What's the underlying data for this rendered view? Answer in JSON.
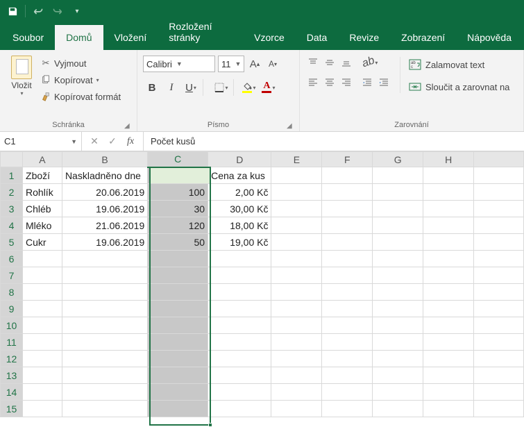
{
  "titlebar": {
    "save_icon": "save-icon",
    "undo_icon": "undo-icon",
    "redo_icon": "redo-icon",
    "customize_icon": "chevron-down-icon"
  },
  "tabs": {
    "items": [
      {
        "label": "Soubor"
      },
      {
        "label": "Domů"
      },
      {
        "label": "Vložení"
      },
      {
        "label": "Rozložení stránky"
      },
      {
        "label": "Vzorce"
      },
      {
        "label": "Data"
      },
      {
        "label": "Revize"
      },
      {
        "label": "Zobrazení"
      },
      {
        "label": "Nápověda"
      }
    ],
    "active_index": 1
  },
  "ribbon": {
    "clipboard": {
      "paste": "Vložit",
      "cut": "Vyjmout",
      "copy": "Kopírovat",
      "format_painter": "Kopírovat formát",
      "group_label": "Schránka"
    },
    "font": {
      "name": "Calibri",
      "size": "11",
      "increase": "A",
      "decrease": "A",
      "bold": "B",
      "italic": "I",
      "underline": "U",
      "fill_color": "#ffff00",
      "font_color": "#c00000",
      "group_label": "Písmo"
    },
    "alignment": {
      "wrap": "Zalamovat text",
      "merge": "Sloučit a zarovnat na",
      "group_label": "Zarovnání"
    }
  },
  "formula_bar": {
    "name_box": "C1",
    "fx_label": "fx",
    "value": "Počet kusů"
  },
  "grid": {
    "columns": [
      "A",
      "B",
      "C",
      "D",
      "E",
      "F",
      "G",
      "H",
      ""
    ],
    "selected_col_index": 2,
    "rows": [
      {
        "n": "1",
        "A": "Zboží",
        "B": "Naskladněno dne",
        "C": "Počet kusů",
        "D": "Cena za kus"
      },
      {
        "n": "2",
        "A": "Rohlík",
        "B": "20.06.2019",
        "C": "100",
        "D": "2,00 Kč"
      },
      {
        "n": "3",
        "A": "Chléb",
        "B": "19.06.2019",
        "C": "30",
        "D": "30,00 Kč"
      },
      {
        "n": "4",
        "A": "Mléko",
        "B": "21.06.2019",
        "C": "120",
        "D": "18,00 Kč"
      },
      {
        "n": "5",
        "A": "Cukr",
        "B": "19.06.2019",
        "C": "50",
        "D": "19,00 Kč"
      },
      {
        "n": "6"
      },
      {
        "n": "7"
      },
      {
        "n": "8"
      },
      {
        "n": "9"
      },
      {
        "n": "10"
      },
      {
        "n": "11"
      },
      {
        "n": "12"
      },
      {
        "n": "13"
      },
      {
        "n": "14"
      },
      {
        "n": "15"
      }
    ]
  },
  "chart_data": {
    "type": "table",
    "columns": [
      "Zboží",
      "Naskladněno dne",
      "Počet kusů",
      "Cena za kus"
    ],
    "rows": [
      [
        "Rohlík",
        "20.06.2019",
        100,
        "2,00 Kč"
      ],
      [
        "Chléb",
        "19.06.2019",
        30,
        "30,00 Kč"
      ],
      [
        "Mléko",
        "21.06.2019",
        120,
        "18,00 Kč"
      ],
      [
        "Cukr",
        "19.06.2019",
        50,
        "19,00 Kč"
      ]
    ]
  }
}
